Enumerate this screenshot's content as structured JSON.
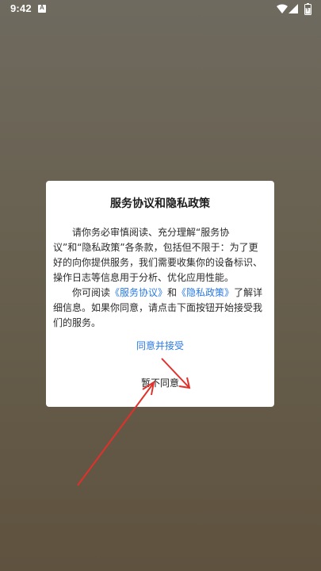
{
  "status_bar": {
    "time": "9:42",
    "icons": [
      "app-notification-icon",
      "wifi-icon",
      "signal-icon",
      "battery-icon"
    ]
  },
  "dialog": {
    "title": "服务协议和隐私政策",
    "paragraph1": "请你务必审慎阅读、充分理解“服务协议”和“隐私政策”各条款，包括但不限于：为了更好的向你提供服务，我们需要收集你的设备标识、操作日志等信息用于分析、优化应用性能。",
    "paragraph2_prefix": "你可阅读",
    "service_agreement_link": "《服务协议》",
    "and": "和",
    "privacy_policy_link": "《隐私政策》",
    "paragraph2_suffix": "了解详细信息。如果你同意，请点击下面按钮开始接受我们的服务。",
    "accept_label": "同意并接受",
    "decline_label": "暂不同意"
  },
  "colors": {
    "link": "#2a7ae2",
    "annotation_arrow": "#e2302a"
  }
}
